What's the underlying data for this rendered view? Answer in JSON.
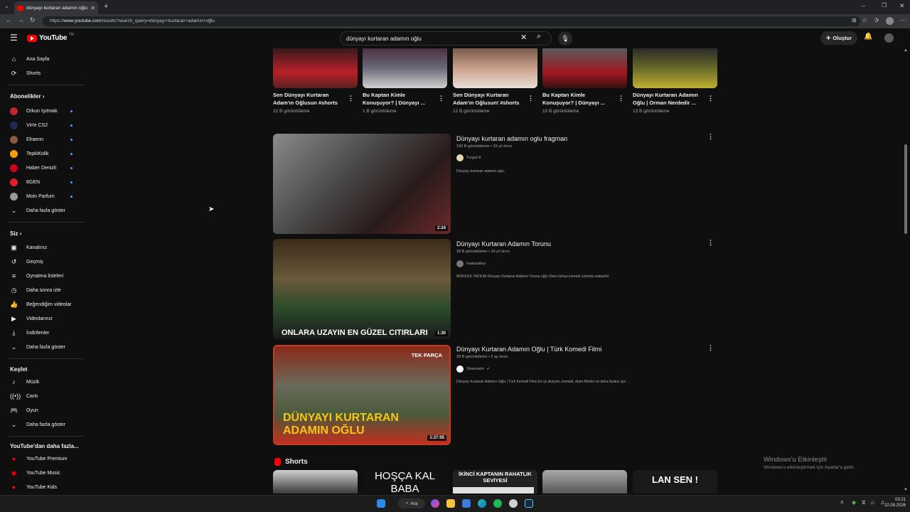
{
  "browser": {
    "tab_title": "dünyayı kurtaran adamın oğlu - YouT",
    "url_prefix": "https://",
    "url_domain": "www.youtube.com",
    "url_path": "/results?search_query=dünyayı+kurtaran+adamın+oğlu"
  },
  "header": {
    "logo_text": "YouTube",
    "logo_country": "TR",
    "search_value": "dünyayı kurtaran adamın oğlu",
    "create_label": "Oluştur"
  },
  "sidebar": {
    "home": "Ana Sayfa",
    "shorts": "Shorts",
    "subs_header": "Abonelikler",
    "subscriptions": [
      {
        "name": "Orkun Işıtmak",
        "color": "#c1272d"
      },
      {
        "name": "Virre CS2",
        "color": "#1c2a55"
      },
      {
        "name": "Elraenn",
        "color": "#8a5a44"
      },
      {
        "name": "TepkiKolik",
        "color": "#f39c12"
      },
      {
        "name": "Haber Denizli",
        "color": "#d0021b"
      },
      {
        "name": "8GEN",
        "color": "#e01e2d"
      },
      {
        "name": "Moin Parfum",
        "color": "#999999"
      }
    ],
    "subs_more": "Daha fazla göster",
    "you_header": "Siz",
    "you_items": [
      "Kanalınız",
      "Geçmiş",
      "Oynatma listeleri",
      "Daha sonra izle",
      "Beğendiğim videolar",
      "Videolarınız",
      "İndirilenler"
    ],
    "you_more": "Daha fazla göster",
    "explore_header": "Keşfet",
    "explore_items": [
      "Müzik",
      "Canlı",
      "Oyun"
    ],
    "explore_more": "Daha fazla göster",
    "more_header": "YouTube'dan daha fazla...",
    "more_items": [
      "YouTube Premium",
      "YouTube Music",
      "YouTube Kids"
    ]
  },
  "shorts_row": [
    {
      "title": "Sen Dünyayı Kurtaran Adam'ın Oğlusun #shorts",
      "views": "22 B görüntüleme"
    },
    {
      "title": "Bu Kaptan Kimle Konuşuyor? | Dünyayı ...",
      "views": "1 B görüntüleme"
    },
    {
      "title": "Sen Dünyayı Kurtaran Adam'ın Oğlusun! #shorts",
      "views": "12 B görüntüleme"
    },
    {
      "title": "Bu Kaptan Kimle Konuşuyor? | Dünyayı ...",
      "views": "10 B görüntüleme"
    },
    {
      "title": "Dünyayı Kurtaran Adamın Oğlu | Orman Nerdedir ...",
      "views": "13 B görüntüleme"
    }
  ],
  "videos": [
    {
      "title": "Dünyayı kurtaran adamın oglu fragman",
      "meta": "100 B görüntüleme • 19 yıl önce",
      "channel": "Turgut K",
      "desc": "Dünyayı kurtaran adamın oglu.",
      "duration": "2:24"
    },
    {
      "title": "Dünyayı Kurtaran Adamın Torunu",
      "meta": "28 B görüntüleme • 19 yıl önce",
      "channel": "makaraboy",
      "desc": "MOHCEK YAZILIM Dünyayı Kurtaran Adamın Torunu oğlu Okan türkçe komedi comedy eskişehir.",
      "duration": "1:30",
      "overlay": "ONLARA UZAYIN EN GÜZEL CITIRLARI"
    },
    {
      "title": "Dünyayı Kurtaran Adamın Oğlu | Türk Komedi Filmi",
      "meta": "39 B görüntüleme • 2 ay önce",
      "channel": "Sinemaön",
      "desc": "Dünyayı Kurtaran Adamın Oğlu | Türk Komedi Filmi En iyi aksiyon, komedi, dram filmleri ve daha fazlası için ...",
      "duration": "1:37:05",
      "overlay": "DÜNYAYI KURTARAN ADAMIN OĞLU",
      "badge": "TEK PARÇA"
    }
  ],
  "shorts_section_title": "Shorts",
  "bottom_shorts": [
    {
      "overlay": ""
    },
    {
      "overlay": "HOŞÇA KAL BABA"
    },
    {
      "overlay": "İKİNCİ KAPTANIN RAHATLIK SEVİYESİ"
    },
    {
      "overlay": ""
    },
    {
      "overlay": "LAN SEN !"
    }
  ],
  "watermark": {
    "title": "Windows'u Etkinleştir",
    "sub": "Windows'u etkinleştirmek için Ayarlar'a gidin."
  },
  "taskbar": {
    "search_label": "Ara",
    "time": "03:21",
    "date": "22.08.2026"
  },
  "colors": {
    "accent": "#ff0000",
    "background": "#0f0f0f",
    "link_blue": "#3ea6ff"
  }
}
